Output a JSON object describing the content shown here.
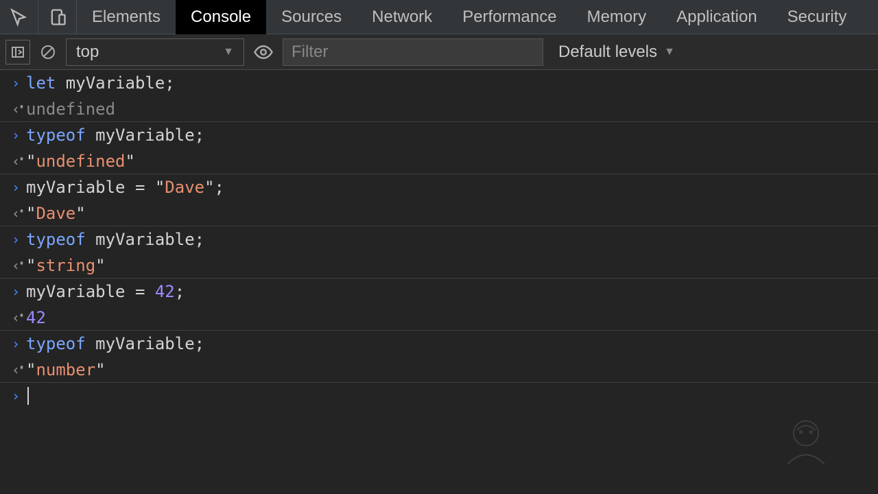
{
  "tabs": {
    "items": [
      "Elements",
      "Console",
      "Sources",
      "Network",
      "Performance",
      "Memory",
      "Application",
      "Security"
    ],
    "active": 1
  },
  "toolbar": {
    "context": "top",
    "filter_placeholder": "Filter",
    "levels": "Default levels"
  },
  "console": {
    "entries": [
      {
        "type": "in",
        "tokens": [
          {
            "t": "let ",
            "c": "kw"
          },
          {
            "t": "myVariable",
            "c": "ident"
          },
          {
            "t": ";",
            "c": "punct"
          }
        ]
      },
      {
        "type": "out",
        "tokens": [
          {
            "t": "undefined",
            "c": "gray"
          }
        ],
        "sep": true
      },
      {
        "type": "in",
        "tokens": [
          {
            "t": "typeof ",
            "c": "kw"
          },
          {
            "t": "myVariable",
            "c": "ident"
          },
          {
            "t": ";",
            "c": "punct"
          }
        ]
      },
      {
        "type": "out",
        "tokens": [
          {
            "t": "\"",
            "c": "quote"
          },
          {
            "t": "undefined",
            "c": "str"
          },
          {
            "t": "\"",
            "c": "quote"
          }
        ],
        "sep": true
      },
      {
        "type": "in",
        "tokens": [
          {
            "t": "myVariable = ",
            "c": "ident"
          },
          {
            "t": "\"",
            "c": "quote"
          },
          {
            "t": "Dave",
            "c": "str"
          },
          {
            "t": "\"",
            "c": "quote"
          },
          {
            "t": ";",
            "c": "punct"
          }
        ]
      },
      {
        "type": "out",
        "tokens": [
          {
            "t": "\"",
            "c": "quote"
          },
          {
            "t": "Dave",
            "c": "str"
          },
          {
            "t": "\"",
            "c": "quote"
          }
        ],
        "sep": true
      },
      {
        "type": "in",
        "tokens": [
          {
            "t": "typeof ",
            "c": "kw"
          },
          {
            "t": "myVariable",
            "c": "ident"
          },
          {
            "t": ";",
            "c": "punct"
          }
        ]
      },
      {
        "type": "out",
        "tokens": [
          {
            "t": "\"",
            "c": "quote"
          },
          {
            "t": "string",
            "c": "str"
          },
          {
            "t": "\"",
            "c": "quote"
          }
        ],
        "sep": true
      },
      {
        "type": "in",
        "tokens": [
          {
            "t": "myVariable = ",
            "c": "ident"
          },
          {
            "t": "42",
            "c": "num"
          },
          {
            "t": ";",
            "c": "punct"
          }
        ]
      },
      {
        "type": "out",
        "tokens": [
          {
            "t": "42",
            "c": "num"
          }
        ],
        "sep": true
      },
      {
        "type": "in",
        "tokens": [
          {
            "t": "typeof ",
            "c": "kw"
          },
          {
            "t": "myVariable",
            "c": "ident"
          },
          {
            "t": ";",
            "c": "punct"
          }
        ]
      },
      {
        "type": "out",
        "tokens": [
          {
            "t": "\"",
            "c": "quote"
          },
          {
            "t": "number",
            "c": "str"
          },
          {
            "t": "\"",
            "c": "quote"
          }
        ],
        "sep": true
      }
    ]
  }
}
